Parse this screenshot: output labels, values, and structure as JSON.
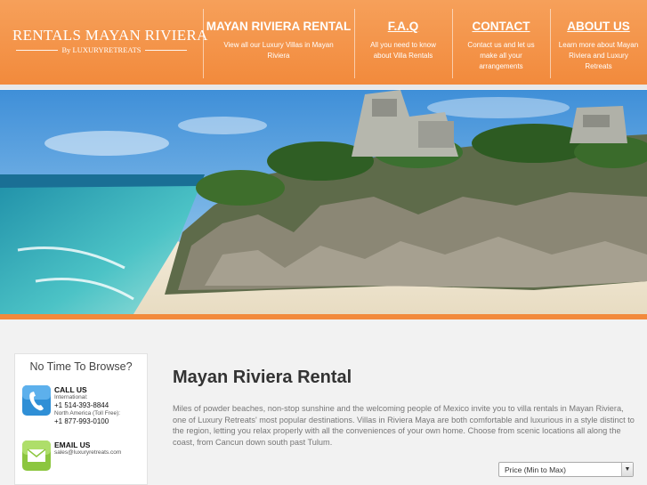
{
  "logo": {
    "main": "RENTALS MAYAN RIVIERA",
    "sub": "By LUXURYRETREATS"
  },
  "nav": [
    {
      "title": "MAYAN RIVIERA RENTAL",
      "desc": "View all our Luxury Villas in Mayan Riviera"
    },
    {
      "title": "F.A.Q",
      "desc": "All you need to know about Villa Rentals"
    },
    {
      "title": "CONTACT",
      "desc": "Contact us and let us make all your arrangements"
    },
    {
      "title": "ABOUT US",
      "desc": "Learn more about Mayan Riviera and Luxury Retreats"
    }
  ],
  "sidebar": {
    "title": "No Time To Browse?",
    "call": {
      "heading": "CALL US",
      "intl_label": "International:",
      "intl_number": "+1 514-393-8844",
      "na_label": "North America (Toll Free):",
      "na_number": "+1 877-993-0100"
    },
    "email": {
      "heading": "EMAIL US",
      "address": "sales@luxuryretreats.com"
    }
  },
  "main": {
    "title": "Mayan Riviera Rental",
    "body": "Miles of powder beaches, non-stop sunshine and the welcoming people of Mexico invite you to villa rentals in Mayan Riviera, one of Luxury Retreats' most popular destinations. Villas in Riviera Maya are both comfortable and luxurious in a style distinct to the region, letting you relax properly with all the conveniences of your own home. Choose from scenic locations all along the coast, from Cancun down south past Tulum."
  },
  "sort": {
    "selected": "Price (Min to Max)"
  },
  "icons": {
    "call": "phone-icon",
    "email": "envelope-icon",
    "dropdown": "chevron-down-icon"
  },
  "colors": {
    "brand_orange": "#f28a3c",
    "phone_blue": "#2f8fd6",
    "email_green": "#8cc63f"
  }
}
